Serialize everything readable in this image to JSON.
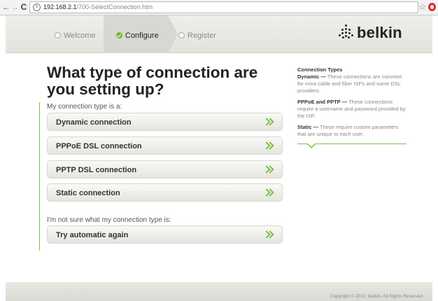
{
  "browser": {
    "address": "192.168.2.1",
    "path": "/700-SelectConnection.htm"
  },
  "steps": {
    "welcome": "Welcome",
    "configure": "Configure",
    "register": "Register"
  },
  "brand": {
    "logo": "belkin"
  },
  "main": {
    "headline": "What type of connection are you setting up?",
    "prompt_type": "My connection type is a:",
    "options": [
      {
        "label": "Dynamic connection"
      },
      {
        "label": "PPPoE DSL connection"
      },
      {
        "label": "PPTP DSL connection"
      },
      {
        "label": "Static connection"
      }
    ],
    "prompt_unsure": "I'm not sure what my connection type is:",
    "retry_label": "Try automatic again"
  },
  "sidebar": {
    "title": "Connection Types",
    "items": [
      {
        "term": "Dynamic —",
        "desc": " These connections are common for most cable and fiber ISPs and some DSL providers."
      },
      {
        "term": "PPPoE and PPTP —",
        "desc": " These connections require a username and password provided by the ISP."
      },
      {
        "term": "Static —",
        "desc": " These require custom parameters that are unique to each user."
      }
    ]
  },
  "footer": {
    "copyright": "Copyright © 2012. Belkin, All Rights Reserved."
  },
  "colors": {
    "accent": "#7ac142",
    "text": "#222222"
  }
}
